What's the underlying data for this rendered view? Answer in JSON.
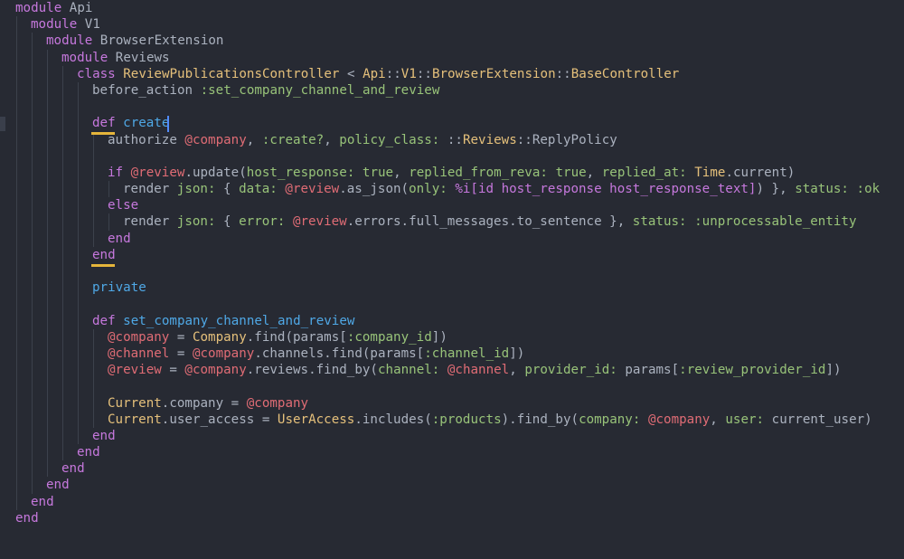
{
  "editor": {
    "language": "ruby",
    "theme_colors": {
      "background": "#272a33",
      "keyword": "#c678dd",
      "def_name": "#4fa8e6",
      "constant": "#e5c07b",
      "symbol": "#98c379",
      "instance_variable": "#e06c75",
      "plain": "#abb2bf",
      "cursor": "#528bff",
      "bracket_match": "#e5b53b"
    },
    "lines": [
      {
        "indent": 0,
        "tokens": [
          [
            "keyword",
            "module"
          ],
          [
            "default",
            " Api"
          ]
        ]
      },
      {
        "indent": 1,
        "tokens": [
          [
            "keyword",
            "module"
          ],
          [
            "default",
            " V1"
          ]
        ]
      },
      {
        "indent": 2,
        "tokens": [
          [
            "keyword",
            "module"
          ],
          [
            "default",
            " BrowserExtension"
          ]
        ]
      },
      {
        "indent": 3,
        "tokens": [
          [
            "keyword",
            "module"
          ],
          [
            "default",
            " Reviews"
          ]
        ]
      },
      {
        "indent": 4,
        "tokens": [
          [
            "keyword",
            "class"
          ],
          [
            "default",
            " "
          ],
          [
            "class",
            "ReviewPublicationsController"
          ],
          [
            "default",
            " < "
          ],
          [
            "class",
            "Api"
          ],
          [
            "default",
            "::"
          ],
          [
            "class",
            "V1"
          ],
          [
            "default",
            "::"
          ],
          [
            "class",
            "BrowserExtension"
          ],
          [
            "default",
            "::"
          ],
          [
            "class",
            "BaseController"
          ]
        ]
      },
      {
        "indent": 5,
        "tokens": [
          [
            "default",
            "before_action "
          ],
          [
            "symbol",
            ":set_company_channel_and_review"
          ]
        ]
      },
      {
        "indent": 5,
        "tokens": []
      },
      {
        "indent": 5,
        "tokens": [
          [
            "keyword",
            "def"
          ],
          [
            "default",
            " "
          ],
          [
            "def",
            "create"
          ]
        ]
      },
      {
        "indent": 6,
        "tokens": [
          [
            "default",
            "authorize "
          ],
          [
            "ivar",
            "@company"
          ],
          [
            "default",
            ", "
          ],
          [
            "symbol",
            ":create?"
          ],
          [
            "default",
            ", "
          ],
          [
            "symbol",
            "policy_class:"
          ],
          [
            "default",
            " ::"
          ],
          [
            "class",
            "Reviews"
          ],
          [
            "default",
            "::ReplyPolicy"
          ]
        ]
      },
      {
        "indent": 6,
        "tokens": []
      },
      {
        "indent": 6,
        "tokens": [
          [
            "keyword",
            "if"
          ],
          [
            "default",
            " "
          ],
          [
            "ivar",
            "@review"
          ],
          [
            "default",
            ".update("
          ],
          [
            "symbol",
            "host_response:"
          ],
          [
            "default",
            " "
          ],
          [
            "ck",
            "true"
          ],
          [
            "default",
            ", "
          ],
          [
            "symbol",
            "replied_from_reva:"
          ],
          [
            "default",
            " "
          ],
          [
            "ck",
            "true"
          ],
          [
            "default",
            ", "
          ],
          [
            "symbol",
            "replied_at:"
          ],
          [
            "default",
            " "
          ],
          [
            "class",
            "Time"
          ],
          [
            "default",
            ".current)"
          ]
        ]
      },
      {
        "indent": 7,
        "tokens": [
          [
            "default",
            "render "
          ],
          [
            "symbol",
            "json:"
          ],
          [
            "default",
            " { "
          ],
          [
            "symbol",
            "data:"
          ],
          [
            "default",
            " "
          ],
          [
            "ivar",
            "@review"
          ],
          [
            "default",
            ".as_json("
          ],
          [
            "symbol",
            "only:"
          ],
          [
            "default",
            " "
          ],
          [
            "literal",
            "%i[id host_response host_response_text]"
          ],
          [
            "default",
            ") }, "
          ],
          [
            "symbol",
            "status:"
          ],
          [
            "default",
            " "
          ],
          [
            "symbol",
            ":ok"
          ]
        ]
      },
      {
        "indent": 6,
        "tokens": [
          [
            "keyword",
            "else"
          ]
        ]
      },
      {
        "indent": 7,
        "tokens": [
          [
            "default",
            "render "
          ],
          [
            "symbol",
            "json:"
          ],
          [
            "default",
            " { "
          ],
          [
            "symbol",
            "error:"
          ],
          [
            "default",
            " "
          ],
          [
            "ivar",
            "@review"
          ],
          [
            "default",
            ".errors.full_messages.to_sentence }, "
          ],
          [
            "symbol",
            "status:"
          ],
          [
            "default",
            " "
          ],
          [
            "symbol",
            ":unprocessable_entity"
          ]
        ]
      },
      {
        "indent": 6,
        "tokens": [
          [
            "keyword",
            "end"
          ]
        ]
      },
      {
        "indent": 5,
        "tokens": [
          [
            "keyword",
            "end"
          ]
        ]
      },
      {
        "indent": 5,
        "tokens": []
      },
      {
        "indent": 5,
        "tokens": [
          [
            "def",
            "private"
          ]
        ]
      },
      {
        "indent": 5,
        "tokens": []
      },
      {
        "indent": 5,
        "tokens": [
          [
            "keyword",
            "def"
          ],
          [
            "default",
            " "
          ],
          [
            "def",
            "set_company_channel_and_review"
          ]
        ]
      },
      {
        "indent": 6,
        "tokens": [
          [
            "ivar",
            "@company"
          ],
          [
            "default",
            " = "
          ],
          [
            "class",
            "Company"
          ],
          [
            "default",
            ".find(params["
          ],
          [
            "symbol",
            ":company_id"
          ],
          [
            "default",
            "])"
          ]
        ]
      },
      {
        "indent": 6,
        "tokens": [
          [
            "ivar",
            "@channel"
          ],
          [
            "default",
            " = "
          ],
          [
            "ivar",
            "@company"
          ],
          [
            "default",
            ".channels.find(params["
          ],
          [
            "symbol",
            ":channel_id"
          ],
          [
            "default",
            "])"
          ]
        ]
      },
      {
        "indent": 6,
        "tokens": [
          [
            "ivar",
            "@review"
          ],
          [
            "default",
            " = "
          ],
          [
            "ivar",
            "@company"
          ],
          [
            "default",
            ".reviews.find_by("
          ],
          [
            "symbol",
            "channel:"
          ],
          [
            "default",
            " "
          ],
          [
            "ivar",
            "@channel"
          ],
          [
            "default",
            ", "
          ],
          [
            "symbol",
            "provider_id:"
          ],
          [
            "default",
            " params["
          ],
          [
            "symbol",
            ":review_provider_id"
          ],
          [
            "default",
            "])"
          ]
        ]
      },
      {
        "indent": 6,
        "tokens": []
      },
      {
        "indent": 6,
        "tokens": [
          [
            "class",
            "Current"
          ],
          [
            "default",
            ".company = "
          ],
          [
            "ivar",
            "@company"
          ]
        ]
      },
      {
        "indent": 6,
        "tokens": [
          [
            "class",
            "Current"
          ],
          [
            "default",
            ".user_access = "
          ],
          [
            "class",
            "UserAccess"
          ],
          [
            "default",
            ".includes("
          ],
          [
            "symbol",
            ":products"
          ],
          [
            "default",
            ").find_by("
          ],
          [
            "symbol",
            "company:"
          ],
          [
            "default",
            " "
          ],
          [
            "ivar",
            "@company"
          ],
          [
            "default",
            ", "
          ],
          [
            "symbol",
            "user:"
          ],
          [
            "default",
            " current_user)"
          ]
        ]
      },
      {
        "indent": 5,
        "tokens": [
          [
            "keyword",
            "end"
          ]
        ]
      },
      {
        "indent": 4,
        "tokens": [
          [
            "keyword",
            "end"
          ]
        ]
      },
      {
        "indent": 3,
        "tokens": [
          [
            "keyword",
            "end"
          ]
        ]
      },
      {
        "indent": 2,
        "tokens": [
          [
            "keyword",
            "end"
          ]
        ]
      },
      {
        "indent": 1,
        "tokens": [
          [
            "keyword",
            "end"
          ]
        ]
      },
      {
        "indent": 0,
        "tokens": [
          [
            "keyword",
            "end"
          ]
        ]
      }
    ]
  }
}
